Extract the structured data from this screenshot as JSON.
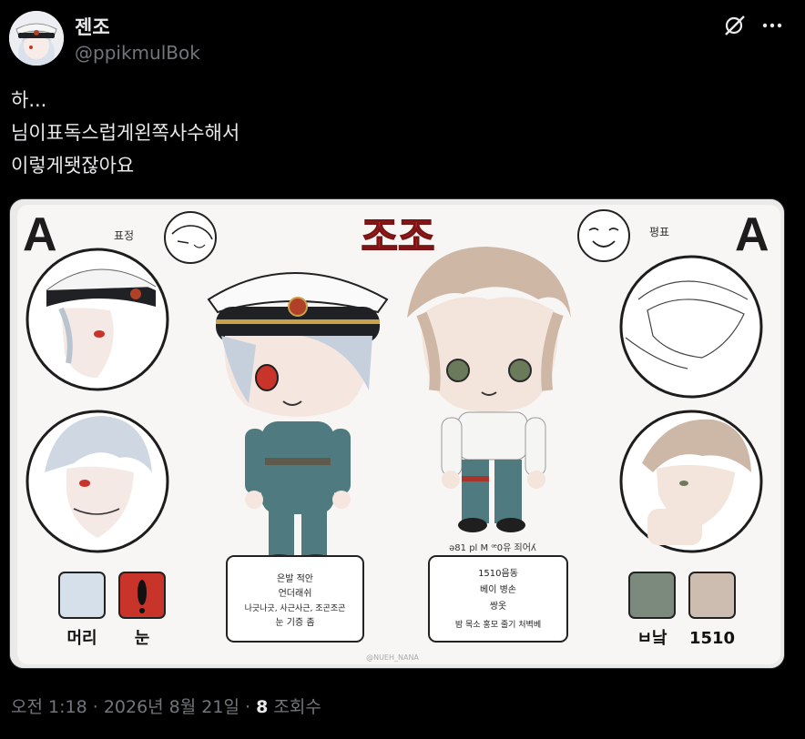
{
  "author": {
    "display_name": "젠조",
    "handle": "@ppikmulBok"
  },
  "tweet": {
    "lines": [
      "하...",
      "님이표독스럽게왼쪽사수해서",
      "이렇게됏잖아요"
    ]
  },
  "sheet": {
    "title": "조조",
    "left_grade": "A",
    "right_grade": "A",
    "left_tag": "표정",
    "right_tag": "평표",
    "left_notes": [
      "은발 적안",
      "언더래쉬",
      "나긋나긋, 사근사근, 조곤조곤",
      "눈 기증 좀"
    ],
    "right_notes": [
      "1510음동",
      "베이 병손",
      "쌍옷",
      "밤 목소 홍모 줄기 처벽베"
    ],
    "right_caption": "ə81 pl M ꟹ0유 죄어ʎ",
    "swatch_labels_left": [
      "머리",
      "눈"
    ],
    "swatch_labels_right": [
      "ㅂ낰",
      "1510"
    ],
    "watermark": "@NUEH_NANA",
    "colors": {
      "hair_left": "#d5e0ea",
      "eye_left": "#c8342a",
      "hair_right": "#7b8a7c",
      "eye_right": "#cdbdb1",
      "uniform": "#4e7a80",
      "title_red": "#c3272b"
    }
  },
  "meta": {
    "time": "오전 1:18",
    "date": "2026년 8월 21일",
    "views_count": "8",
    "views_label": "조회수"
  },
  "icons": {
    "grok": "grok-icon",
    "more": "more-icon"
  }
}
